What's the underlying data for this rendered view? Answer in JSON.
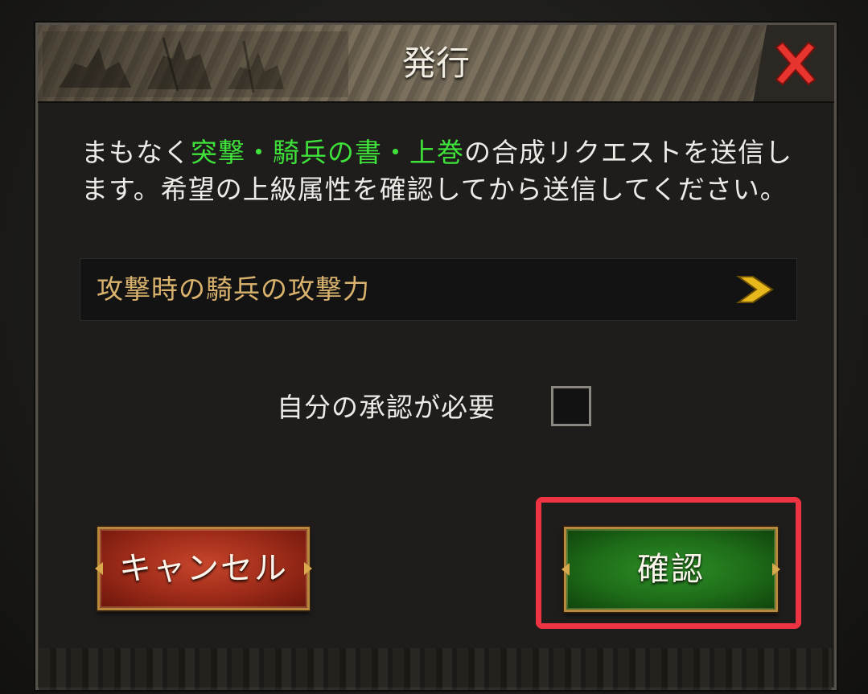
{
  "dialog": {
    "title": "発行",
    "close_icon": "close-icon",
    "message": {
      "prefix": "まもなく",
      "item_name": "突撃・騎兵の書・上巻",
      "suffix": "の合成リクエストを送信します。希望の上級属性を確認してから送信してください。"
    },
    "attribute_select": {
      "value": "攻撃時の騎兵の攻撃力",
      "icon": "chevron-right-icon"
    },
    "approval": {
      "label": "自分の承認が必要",
      "checked": false
    },
    "buttons": {
      "cancel": "キャンセル",
      "confirm": "確認"
    },
    "colors": {
      "highlight_text": "#3fe23a",
      "attribute_text": "#d9b36e",
      "cancel_button": "#9b2a18",
      "confirm_button": "#1e6c18",
      "close_icon": "#e8342e",
      "annotation_box": "#ee3343"
    }
  }
}
